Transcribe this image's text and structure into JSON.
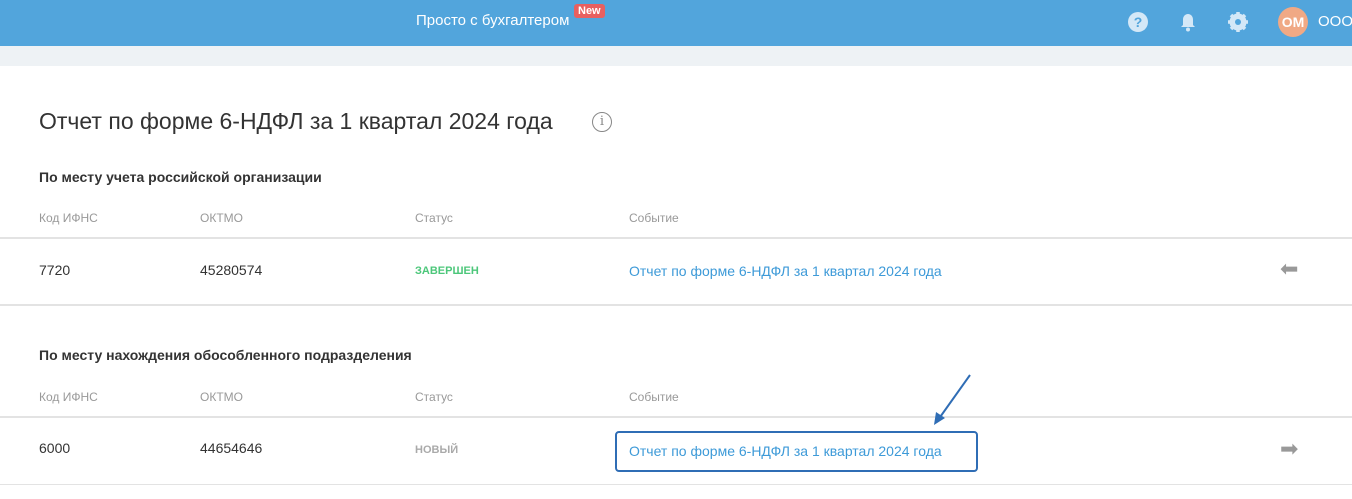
{
  "header": {
    "brand": "Просто с бухгалтером",
    "badge": "New",
    "avatar": "ОМ",
    "org": "ООО"
  },
  "title": "Отчет по форме 6-НДФЛ за 1 квартал 2024 года",
  "columns": [
    "Код ИФНС",
    "ОКТМО",
    "Статус",
    "Событие"
  ],
  "sections": [
    {
      "title": "По месту учета российской организации",
      "row": {
        "code": "7720",
        "oktmo": "45280574",
        "status": "ЗАВЕРШЕН",
        "status_color": "#4cc77a",
        "event": "Отчет по форме 6-НДФЛ за 1 квартал 2024 года"
      }
    },
    {
      "title": "По месту нахождения обособленного подразделения",
      "row": {
        "code": "6000",
        "oktmo": "44654646",
        "status": "НОВЫЙ",
        "status_color": "#aaaaaa",
        "event": "Отчет по форме 6-НДФЛ за 1 квартал 2024 года"
      }
    }
  ]
}
